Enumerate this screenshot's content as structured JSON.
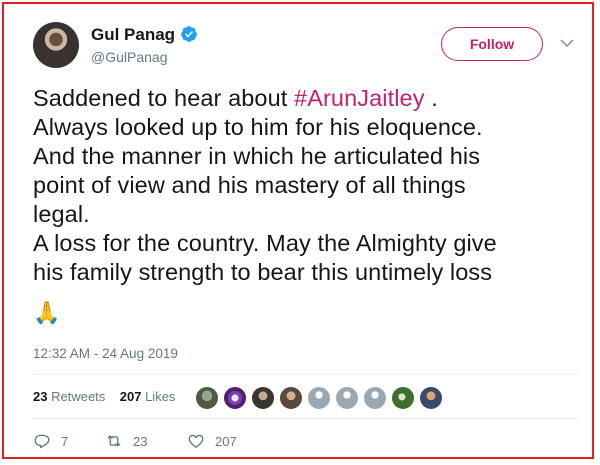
{
  "user": {
    "name": "Gul Panag",
    "handle": "@GulPanag",
    "follow_label": "Follow"
  },
  "tweet": {
    "lines": [
      {
        "before": "Saddened to hear about ",
        "hashtag": "#ArunJaitley",
        "after": " ."
      },
      {
        "text": "Always looked up to him for his eloquence."
      },
      {
        "text": "And the manner in which he articulated his"
      },
      {
        "text": "point of view and his mastery of all things"
      },
      {
        "text": "legal."
      },
      {
        "text": "A loss for the country. May the Almighty give"
      },
      {
        "text": "his family strength to bear this untimely loss"
      }
    ],
    "emoji": "🙏",
    "timestamp": "12:32 AM - 24 Aug 2019"
  },
  "stats": {
    "retweets_count": "23",
    "retweets_label": "Retweets",
    "likes_count": "207",
    "likes_label": "Likes"
  },
  "actions": {
    "reply_count": "7",
    "retweet_count": "23",
    "like_count": "207"
  },
  "colors": {
    "accent": "#c3206e",
    "verified": "#1da1f2",
    "border": "#e0201d",
    "muted": "#657786"
  }
}
